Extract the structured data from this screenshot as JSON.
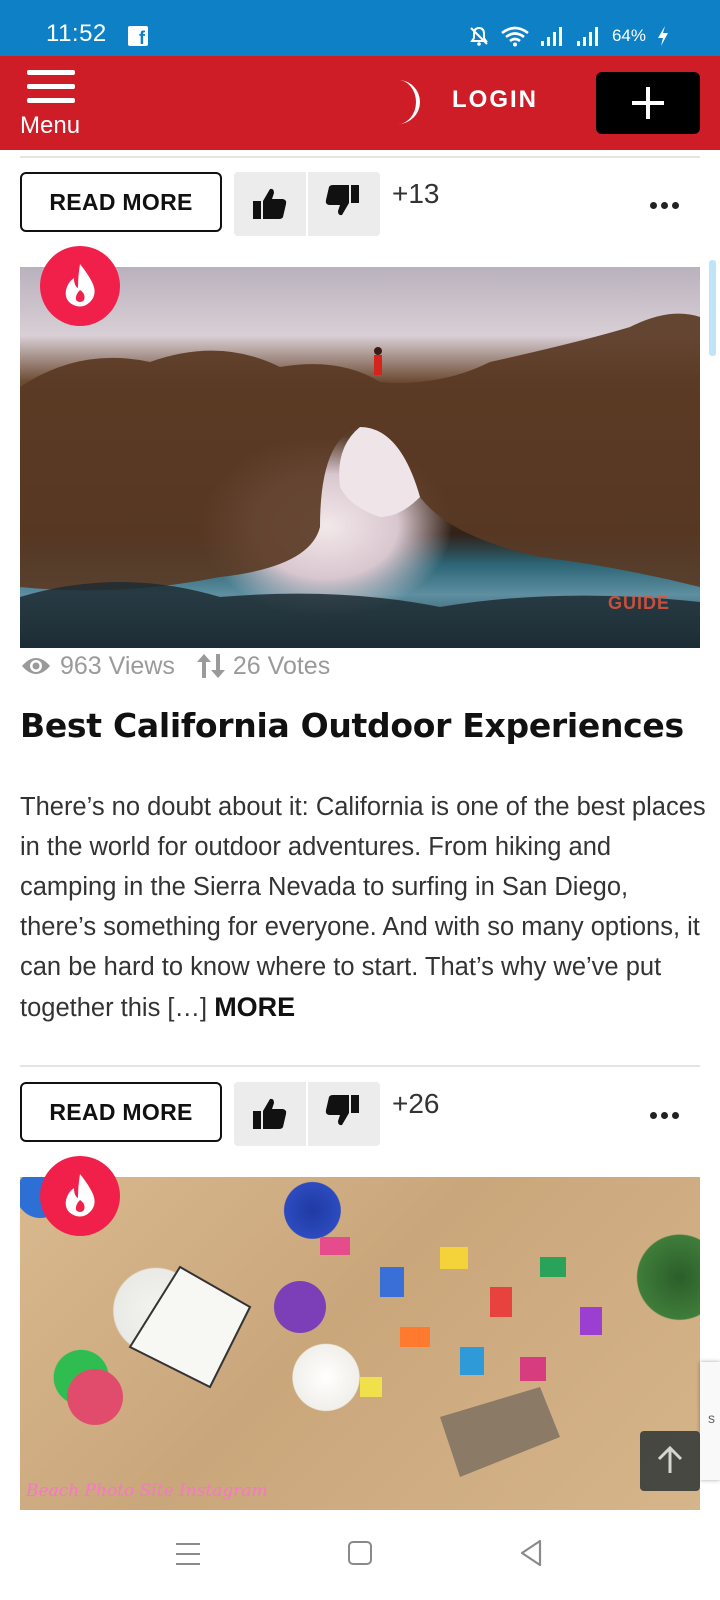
{
  "status_bar": {
    "time": "11:52",
    "battery": "64%",
    "icons": [
      "facebook-icon",
      "mute-icon",
      "wifi-icon",
      "signal-icon",
      "signal-icon",
      "charging-icon"
    ]
  },
  "header": {
    "menu_label": "Menu",
    "login_label": "LOGIN",
    "accent_color": "#cf1d27",
    "icons": [
      "hamburger-icon",
      "moon-icon",
      "plus-icon"
    ]
  },
  "posts": [
    {
      "read_more_label": "READ MORE",
      "score": "+13"
    },
    {
      "badge": "hot-fire-icon",
      "image": "rock-arch-seascape",
      "watermark": "GUIDE",
      "views": "963 Views",
      "votes": "26 Votes",
      "title": "Best California Outdoor Experiences",
      "excerpt": "There’s no doubt about it: California is one of the best places in the world for outdoor adventures. From hiking and camping in the Sierra Nevada to surfing in San Diego, there’s something for everyone. And with so many options, it can be hard to know where to start. That’s why we’ve put together this […] ",
      "more_label": "MORE",
      "read_more_label": "READ MORE",
      "score": "+26"
    },
    {
      "badge": "hot-fire-icon",
      "image": "aerial-beach-crowd",
      "watermark": "Beach Photo Site Instagram"
    }
  ],
  "recaptcha_text": "s",
  "nav_bar": {
    "icons": [
      "recent-apps-icon",
      "home-icon",
      "back-icon"
    ]
  }
}
